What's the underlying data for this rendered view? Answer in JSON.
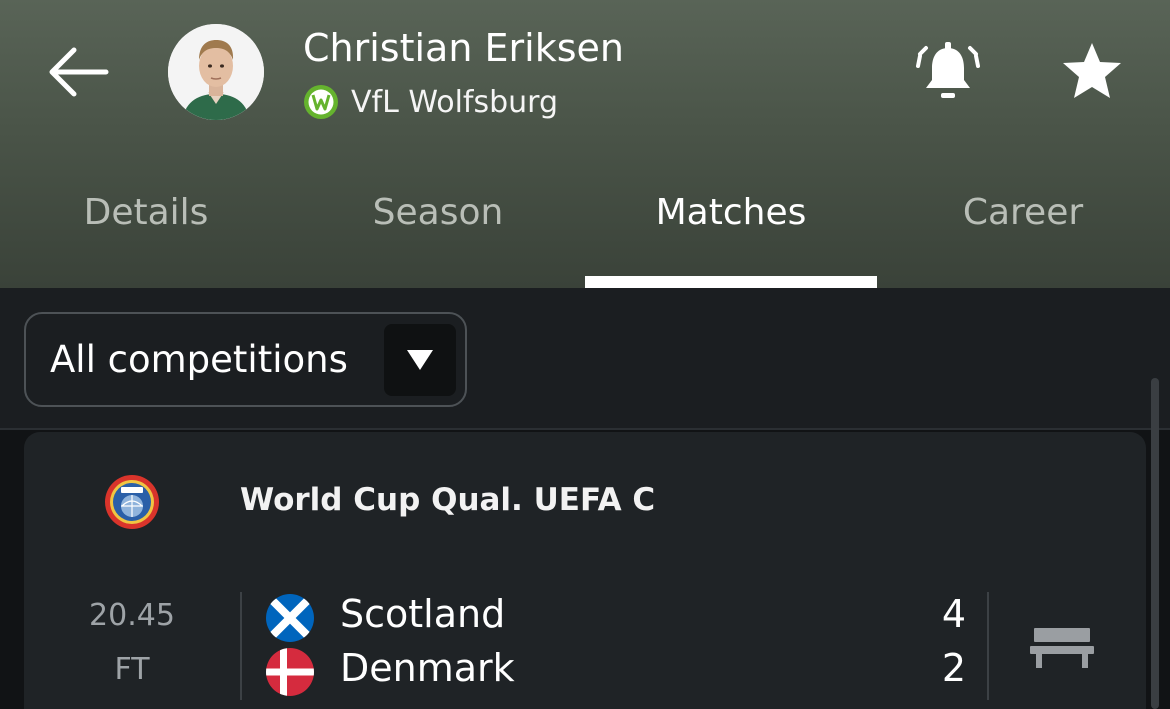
{
  "header": {
    "back_icon": "arrow-left-icon",
    "player_name": "Christian Eriksen",
    "club_name": "VfL Wolfsburg",
    "club_logo_color": "#65b32e",
    "notification_icon": "bell-ringing-icon",
    "favorite_icon": "star-icon"
  },
  "tabs": [
    {
      "label": "Details",
      "active": false
    },
    {
      "label": "Season",
      "active": false
    },
    {
      "label": "Matches",
      "active": true
    },
    {
      "label": "Career",
      "active": false
    }
  ],
  "filter": {
    "selected": "All competitions",
    "caret_icon": "triangle-down-icon"
  },
  "match": {
    "competition": "World Cup Qual. UEFA C",
    "competition_logo": "uefa-logo-icon",
    "time": "20.45",
    "status": "FT",
    "home_team": {
      "name": "Scotland",
      "score": "4",
      "flag": "scotland-flag-icon"
    },
    "away_team": {
      "name": "Denmark",
      "score": "2",
      "flag": "denmark-flag-icon"
    },
    "player_status_icon": "bench-icon"
  },
  "colors": {
    "header_bg": "#4a5448",
    "page_bg": "#111315",
    "card_bg": "#1f2326",
    "tab_inactive": "#b9beb7",
    "tab_active": "#ffffff"
  }
}
